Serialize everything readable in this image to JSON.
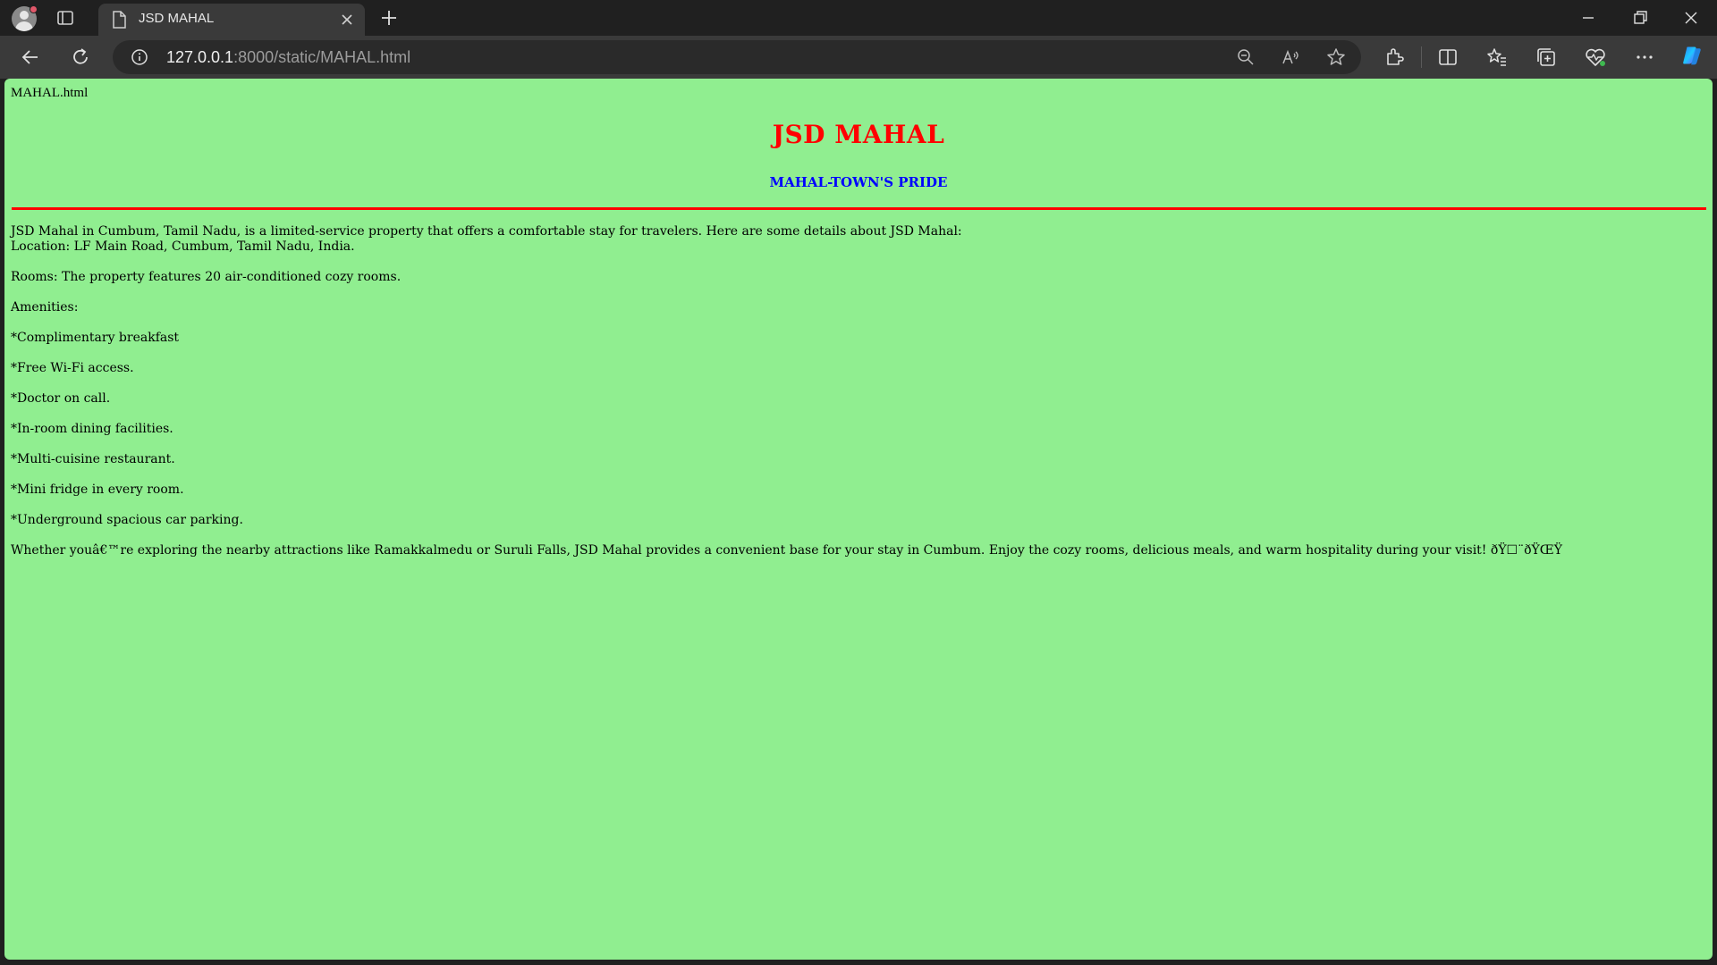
{
  "browser": {
    "tab_title": "JSD MAHAL",
    "url_host": "127.0.0.1",
    "url_rest": ":8000/static/MAHAL.html"
  },
  "page": {
    "file_label": "MAHAL.html",
    "title": "JSD MAHAL",
    "subtitle": "MAHAL-TOWN'S PRIDE",
    "intro": "JSD Mahal in Cumbum, Tamil Nadu, is a limited-service property that offers a comfortable stay for travelers. Here are some details about JSD Mahal:",
    "location": "Location: LF Main Road, Cumbum, Tamil Nadu, India.",
    "rooms": "Rooms: The property features 20 air-conditioned cozy rooms.",
    "amenities_heading": "Amenities:",
    "amenities": [
      "*Complimentary breakfast",
      "*Free Wi-Fi access.",
      "*Doctor on call.",
      "*In-room dining facilities.",
      "*Multi-cuisine restaurant.",
      "*Mini fridge in every room.",
      "*Underground spacious car parking."
    ],
    "closing": "Whether youâ€™re exploring the nearby attractions like Ramakkalmedu or Suruli Falls, JSD Mahal provides a convenient base for your stay in Cumbum. Enjoy the cozy rooms, delicious meals, and warm hospitality during your visit! ðŸ☐¨ðŸŒŸ"
  },
  "colors": {
    "page_background": "#90ee90",
    "title": "#ff0000",
    "subtitle": "#0000ff",
    "rule": "#ff0000"
  }
}
